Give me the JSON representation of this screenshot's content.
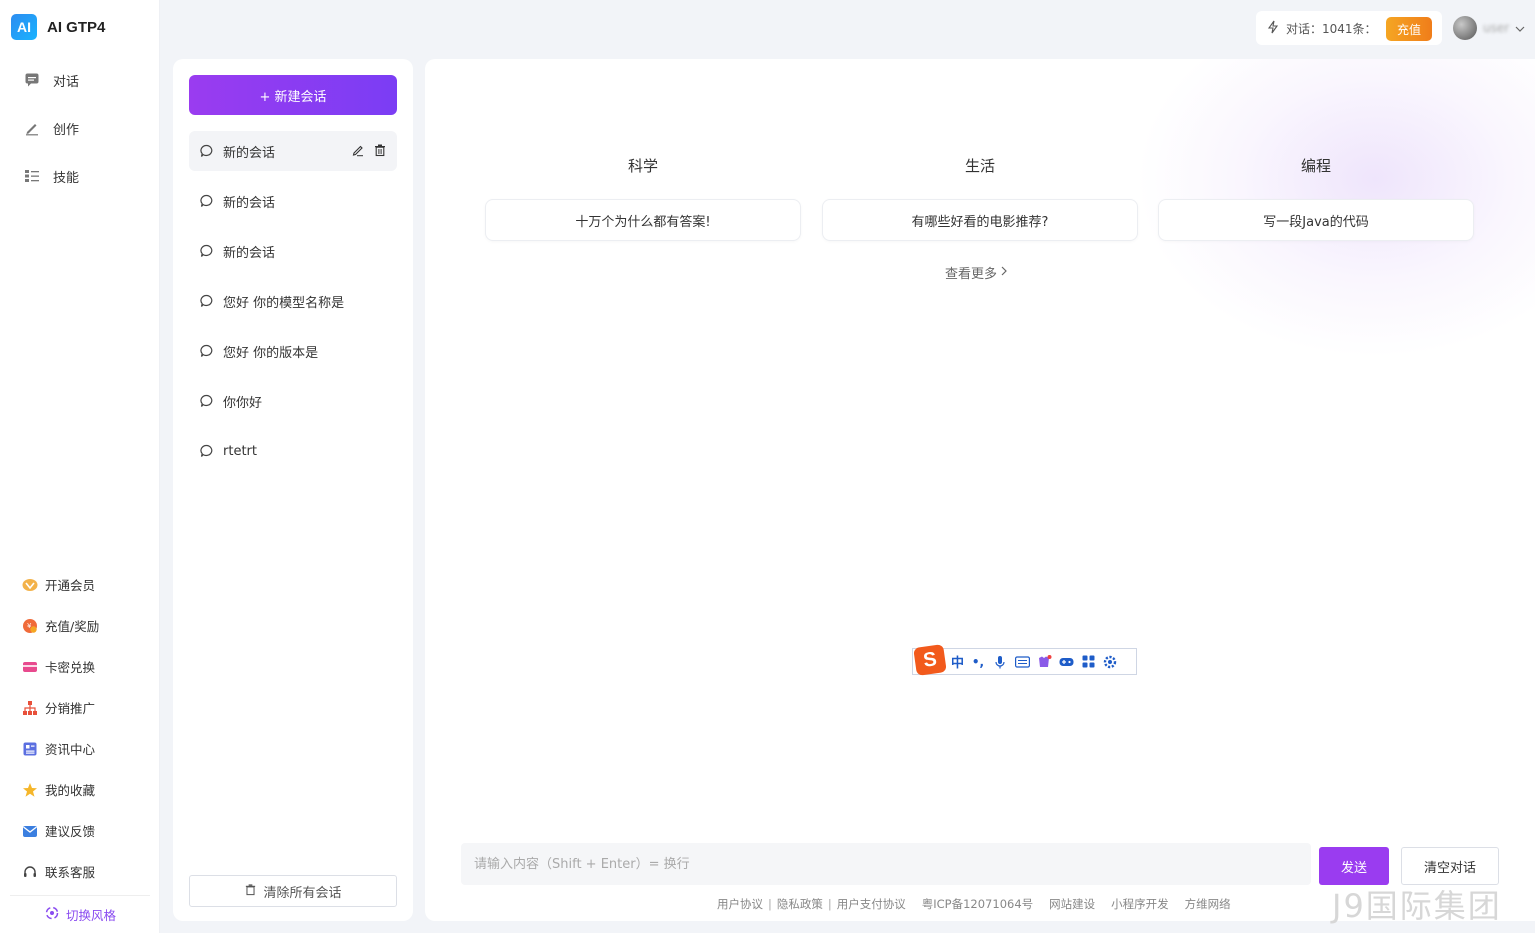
{
  "brand": {
    "logo_text": "AI",
    "title": "AI GTP4"
  },
  "nav": {
    "main_items": [
      {
        "label": "对话",
        "icon": "chat-icon"
      },
      {
        "label": "创作",
        "icon": "pen-icon"
      },
      {
        "label": "技能",
        "icon": "list-icon"
      }
    ],
    "bottom_items": [
      {
        "label": "开通会员",
        "icon": "vip-icon"
      },
      {
        "label": "充值/奖励",
        "icon": "gift-icon"
      },
      {
        "label": "卡密兑换",
        "icon": "card-icon"
      },
      {
        "label": "分销推广",
        "icon": "network-icon"
      },
      {
        "label": "资讯中心",
        "icon": "news-icon"
      },
      {
        "label": "我的收藏",
        "icon": "star-icon"
      },
      {
        "label": "建议反馈",
        "icon": "mail-icon"
      },
      {
        "label": "联系客服",
        "icon": "headset-icon"
      }
    ],
    "switch_style": "切换风格"
  },
  "conversations": {
    "new_chat_label": "+ 新建会话",
    "items": [
      "新的会话",
      "新的会话",
      "新的会话",
      "您好 你的模型名称是",
      "您好 你的版本是",
      "你你好",
      "rtetrt"
    ],
    "clear_all_label": "清除所有会话"
  },
  "main": {
    "categories": [
      {
        "title": "科学",
        "prompt": "十万个为什么都有答案!"
      },
      {
        "title": "生活",
        "prompt": "有哪些好看的电影推荐?"
      },
      {
        "title": "编程",
        "prompt": "写一段Java的代码"
      }
    ],
    "see_more": "查看更多",
    "input_placeholder": "请输入内容（Shift + Enter）= 换行",
    "send_label": "发送",
    "clear_label": "清空对话"
  },
  "ime": {
    "logo": "S",
    "mode": "中",
    "punct": "•,"
  },
  "footer": {
    "links": [
      "用户协议",
      "隐私政策",
      "用户支付协议"
    ],
    "icp": "粤ICP备12071064号",
    "extra": [
      "网站建设",
      "小程序开发",
      "方维网络"
    ]
  },
  "top": {
    "dialog_count": "对话：1041条：",
    "recharge_label": "充值",
    "user_name": "user"
  },
  "watermark": "J9国际集团"
}
